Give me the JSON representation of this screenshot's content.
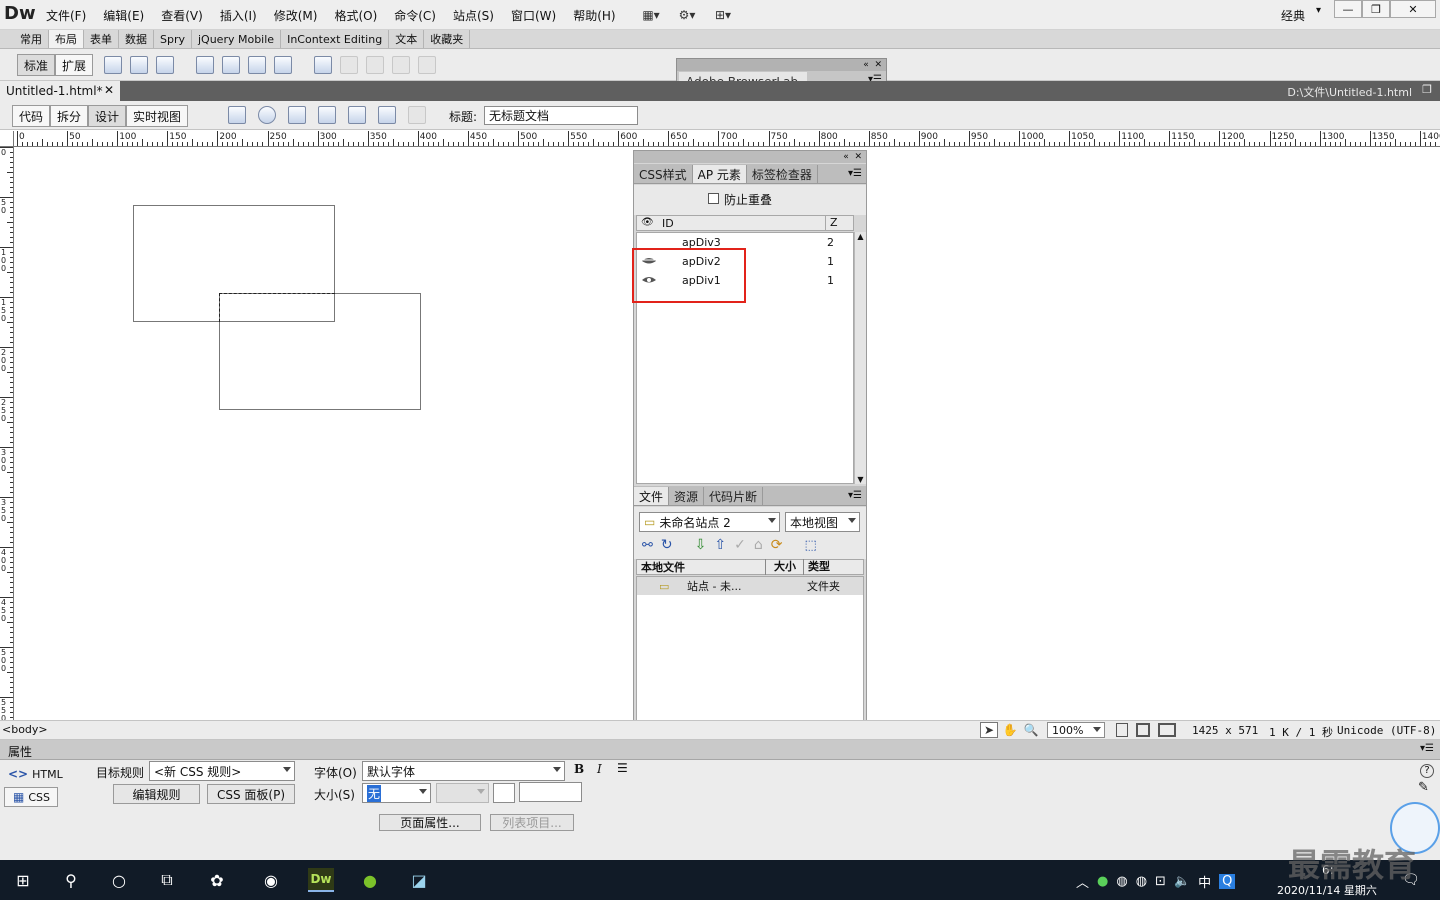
{
  "app": {
    "logo": "Dw",
    "workspace": "经典"
  },
  "menu": [
    "文件(F)",
    "编辑(E)",
    "查看(V)",
    "插入(I)",
    "修改(M)",
    "格式(O)",
    "命令(C)",
    "站点(S)",
    "窗口(W)",
    "帮助(H)"
  ],
  "insert_tabs": [
    "常用",
    "布局",
    "表单",
    "数据",
    "Spry",
    "jQuery Mobile",
    "InContext Editing",
    "文本",
    "收藏夹"
  ],
  "insert_bar": {
    "standard": "标准",
    "expanded": "扩展"
  },
  "browserlab": {
    "label": "Adobe BrowserLab"
  },
  "document": {
    "tab_name": "Untitled-1.html*",
    "path": "D:\\文件\\Untitled-1.html"
  },
  "doc_toolbar": {
    "views": [
      "代码",
      "拆分",
      "设计",
      "实时视图"
    ],
    "title_label": "标题:",
    "title_value": "无标题文档"
  },
  "ruler_h": [
    "0",
    "50",
    "100",
    "150",
    "200",
    "250",
    "300",
    "350",
    "400",
    "450",
    "500",
    "550",
    "600",
    "650",
    "700",
    "750",
    "800",
    "850",
    "900",
    "950",
    "1000",
    "1050",
    "1100",
    "1150",
    "1200",
    "1250",
    "1300",
    "1350",
    "1400"
  ],
  "ruler_v": [
    "0",
    "5\n0",
    "1\n0\n0",
    "1\n5\n0",
    "2\n0\n0",
    "2\n5\n0",
    "3\n0\n0",
    "3\n5\n0",
    "4\n0\n0",
    "4\n5\n0",
    "5\n0\n0",
    "5\n5\n0"
  ],
  "ap_panel": {
    "tabs": [
      "CSS样式",
      "AP 元素",
      "标签检查器"
    ],
    "prevent_overlap": "防止重叠",
    "col_id": "ID",
    "col_z": "Z",
    "rows": [
      {
        "id": "apDiv3",
        "z": "2"
      },
      {
        "id": "apDiv2",
        "z": "1"
      },
      {
        "id": "apDiv1",
        "z": "1"
      }
    ]
  },
  "files_panel": {
    "tabs": [
      "文件",
      "资源",
      "代码片断"
    ],
    "site": "未命名站点 2",
    "view": "本地视图",
    "cols": [
      "本地文件",
      "大小",
      "类型"
    ],
    "row": {
      "name": "站点 - 未...",
      "type": "文件夹"
    }
  },
  "statusbar": {
    "tag": "<body>",
    "zoom": "100%",
    "size": "1425 x 571",
    "download": "1 K / 1 秒",
    "encoding": "Unicode (UTF-8)"
  },
  "properties": {
    "title": "属性",
    "html": "HTML",
    "css": "CSS",
    "target_rule_label": "目标规则",
    "target_rule": "<新 CSS 规则>",
    "edit_rule": "编辑规则",
    "css_panel": "CSS 面板(P)",
    "font_label": "字体(O)",
    "font_value": "默认字体",
    "size_label": "大小(S)",
    "size_value": "无",
    "bold": "B",
    "italic": "I",
    "page_props": "页面属性...",
    "list_item": "列表项目..."
  },
  "taskbar": {
    "ime": "中",
    "time": "6:",
    "date": "2020/11/14 星期六",
    "watermark": "最需教育"
  }
}
